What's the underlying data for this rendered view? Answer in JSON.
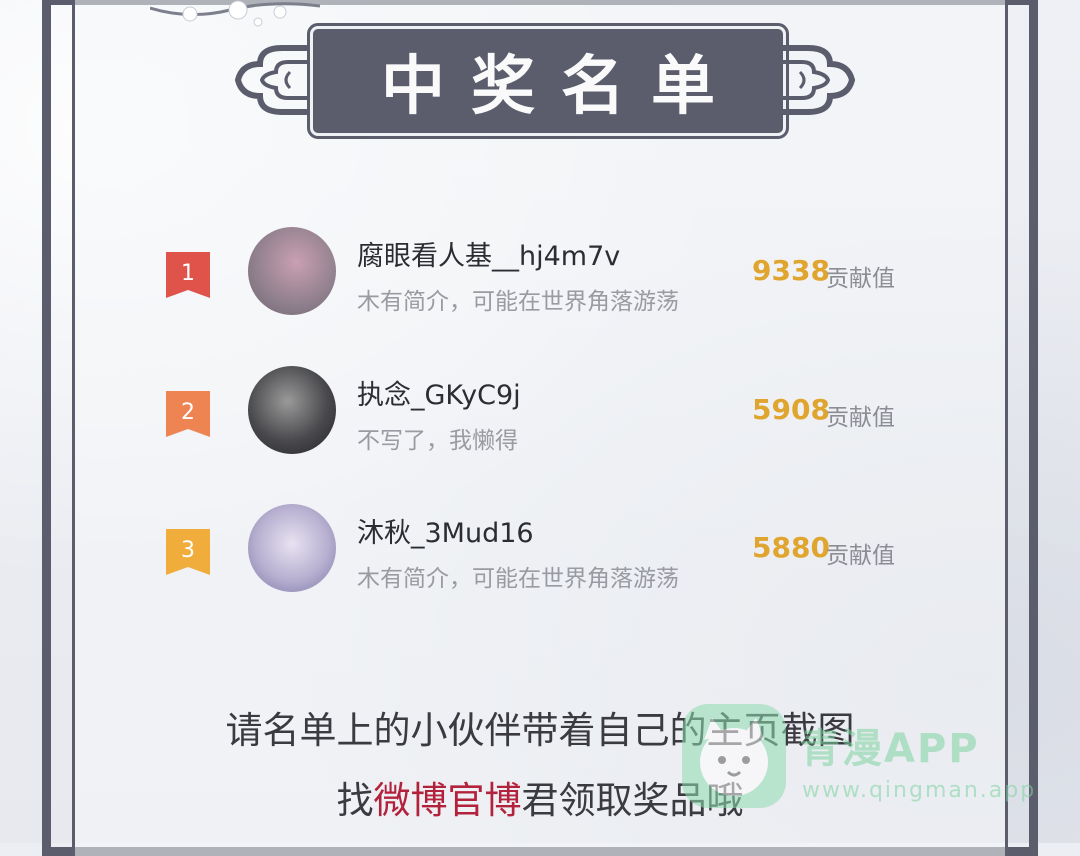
{
  "header": {
    "title": "中奖名单"
  },
  "winners": [
    {
      "rank": "1",
      "name": "腐眼看人基__hj4m7v",
      "bio": "木有简介，可能在世界角落游荡",
      "score": "9338",
      "unit": "贡献值",
      "badge_color": "#e0534b"
    },
    {
      "rank": "2",
      "name": "执念_GKyC9j",
      "bio": "不写了，我懒得",
      "score": "5908",
      "unit": "贡献值",
      "badge_color": "#ef8453"
    },
    {
      "rank": "3",
      "name": "沐秋_3Mud16",
      "bio": "木有简介，可能在世界角落游荡",
      "score": "5880",
      "unit": "贡献值",
      "badge_color": "#f0ad3c"
    }
  ],
  "footer": {
    "line1": "请名单上的小伙伴带着自己的主页截图",
    "line2_pre": "找",
    "line2_highlight": "微博官博",
    "line2_post": "君领取奖品哦"
  },
  "watermark": {
    "title": "青漫APP",
    "url": "www.qingman.app"
  },
  "colors": {
    "frame": "#5b5d6d",
    "score": "#e0a52e",
    "highlight": "#b3223c"
  }
}
